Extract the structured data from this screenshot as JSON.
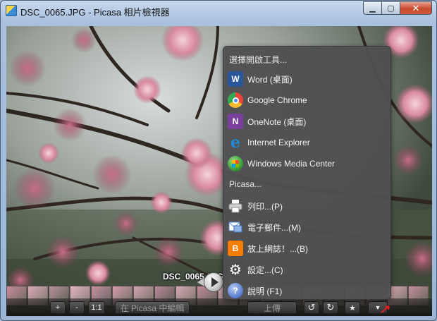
{
  "window": {
    "title": "DSC_0065.JPG - Picasa 相片檢視器",
    "min_glyph": "▁",
    "max_glyph": "▢",
    "close_glyph": "✕"
  },
  "photo": {
    "filename_label": "DSC_0065.JPG"
  },
  "menu": {
    "header_open_with": "選擇開啟工具...",
    "open_with": [
      {
        "label": "Word (桌面)",
        "icon": "word-icon",
        "color": "#2b579a",
        "glyph": "W"
      },
      {
        "label": "Google Chrome",
        "icon": "chrome-icon",
        "color": "#e8453c",
        "glyph": ""
      },
      {
        "label": "OneNote (桌面)",
        "icon": "onenote-icon",
        "color": "#7b3f9e",
        "glyph": "N"
      },
      {
        "label": "Internet Explorer",
        "icon": "ie-icon",
        "color": "#1f8bd8",
        "glyph": "e"
      },
      {
        "label": "Windows Media Center",
        "icon": "media-center-icon",
        "color": "#3e9b3a",
        "glyph": ""
      }
    ],
    "header_picasa": "Picasa...",
    "picasa_items": [
      {
        "label": "列印...(P)",
        "icon": "printer-icon",
        "color": "#d8d8d8",
        "glyph": ""
      },
      {
        "label": "電子郵件...(M)",
        "icon": "email-icon",
        "color": "#5b8fd4",
        "glyph": ""
      },
      {
        "label": "放上網誌！...(B)",
        "icon": "blogger-icon",
        "color": "#f57d00",
        "glyph": "B"
      },
      {
        "label": "設定...(C)",
        "icon": "gear-icon",
        "color": "#4f4f52",
        "glyph": "⚙"
      },
      {
        "label": "說明 (F1)",
        "icon": "help-icon",
        "color": "#6a8fd8",
        "glyph": "?"
      }
    ]
  },
  "toolbar": {
    "zoom_in": "+",
    "zoom_out": "-",
    "actual_size": "1:1",
    "edit_in_picasa": "在 Picasa 中編輯",
    "upload": "上傳",
    "rotate_left": "↺",
    "rotate_right": "↻",
    "star": "★",
    "more": "▼"
  },
  "colors": {
    "accent_red": "#e02020"
  }
}
